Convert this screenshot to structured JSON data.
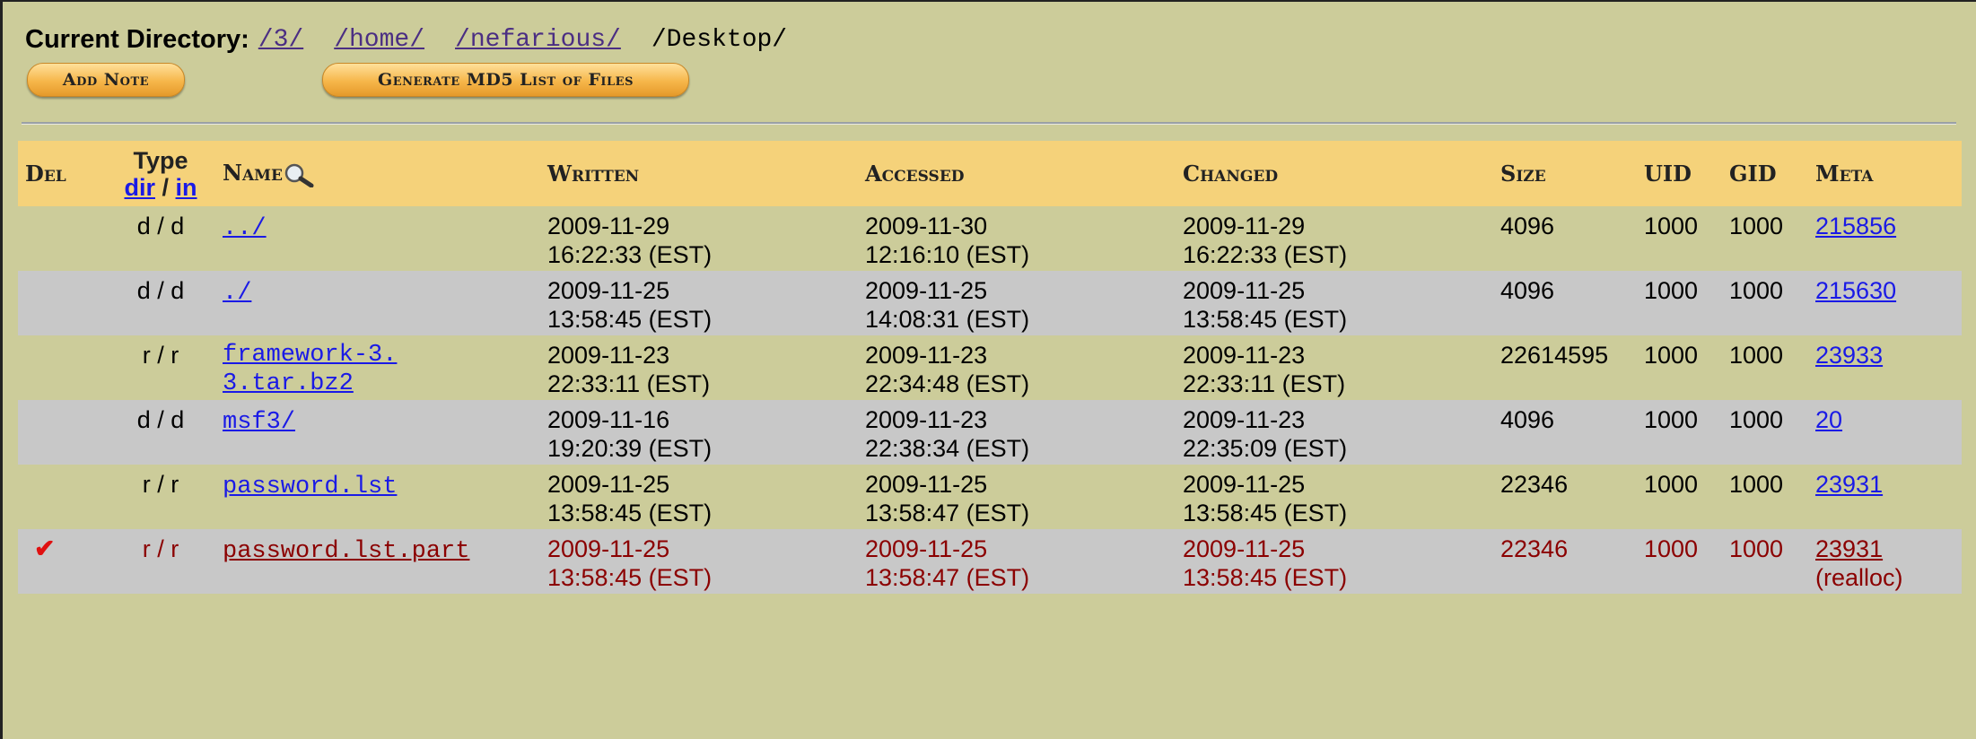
{
  "header": {
    "label": "Current Directory:",
    "path": [
      {
        "text": "/3/",
        "link": true
      },
      {
        "text": "/home/",
        "link": true
      },
      {
        "text": "/nefarious/",
        "link": true
      },
      {
        "text": "/Desktop/",
        "link": false
      }
    ],
    "add_note": "Add Note",
    "generate_md5": "Generate MD5 List of Files"
  },
  "columns": {
    "del": "Del",
    "type": "Type",
    "type_dir": "dir",
    "type_sep": "/",
    "type_in": "in",
    "name": "Name",
    "written": "Written",
    "accessed": "Accessed",
    "changed": "Changed",
    "size": "Size",
    "uid": "UID",
    "gid": "GID",
    "meta": "Meta"
  },
  "rows": [
    {
      "del": "",
      "type": "d / d",
      "name": "../",
      "written": [
        "2009-11-29",
        "16:22:33 (EST)"
      ],
      "accessed": [
        "2009-11-30",
        "12:16:10 (EST)"
      ],
      "changed": [
        "2009-11-29",
        "16:22:33 (EST)"
      ],
      "size": "4096",
      "uid": "1000",
      "gid": "1000",
      "meta": "215856",
      "meta_extra": ""
    },
    {
      "del": "",
      "type": "d / d",
      "name": "./",
      "written": [
        "2009-11-25",
        "13:58:45 (EST)"
      ],
      "accessed": [
        "2009-11-25",
        "14:08:31 (EST)"
      ],
      "changed": [
        "2009-11-25",
        "13:58:45 (EST)"
      ],
      "size": "4096",
      "uid": "1000",
      "gid": "1000",
      "meta": "215630",
      "meta_extra": ""
    },
    {
      "del": "",
      "type": "r / r",
      "name": "framework-3.3.tar.bz2",
      "written": [
        "2009-11-23",
        "22:33:11 (EST)"
      ],
      "accessed": [
        "2009-11-23",
        "22:34:48 (EST)"
      ],
      "changed": [
        "2009-11-23",
        "22:33:11 (EST)"
      ],
      "size": "22614595",
      "uid": "1000",
      "gid": "1000",
      "meta": "23933",
      "meta_extra": ""
    },
    {
      "del": "",
      "type": "d / d",
      "name": "msf3/",
      "written": [
        "2009-11-16",
        "19:20:39 (EST)"
      ],
      "accessed": [
        "2009-11-23",
        "22:38:34 (EST)"
      ],
      "changed": [
        "2009-11-23",
        "22:35:09 (EST)"
      ],
      "size": "4096",
      "uid": "1000",
      "gid": "1000",
      "meta": "20",
      "meta_extra": ""
    },
    {
      "del": "",
      "type": "r / r",
      "name": "password.lst",
      "written": [
        "2009-11-25",
        "13:58:45 (EST)"
      ],
      "accessed": [
        "2009-11-25",
        "13:58:47 (EST)"
      ],
      "changed": [
        "2009-11-25",
        "13:58:45 (EST)"
      ],
      "size": "22346",
      "uid": "1000",
      "gid": "1000",
      "meta": "23931",
      "meta_extra": ""
    },
    {
      "del": "✔",
      "type": "r / r",
      "name": "password.lst.part",
      "written": [
        "2009-11-25",
        "13:58:45 (EST)"
      ],
      "accessed": [
        "2009-11-25",
        "13:58:47 (EST)"
      ],
      "changed": [
        "2009-11-25",
        "13:58:45 (EST)"
      ],
      "size": "22346",
      "uid": "1000",
      "gid": "1000",
      "meta": "23931",
      "meta_extra": "(realloc)",
      "deleted": true
    }
  ],
  "colors": {
    "background": "#cccc9a",
    "header_row": "#f5d27a",
    "alt_row": "#c8c8c8",
    "link": "#1a1ae6",
    "deleted": "#8b0000"
  },
  "icons": {
    "name_search": "magnifier-icon",
    "deleted_mark": "checkmark-icon"
  }
}
